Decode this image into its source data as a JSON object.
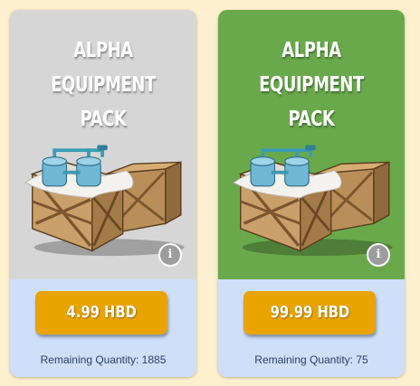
{
  "cards": [
    {
      "title_line1": "ALPHA EQUIPMENT",
      "title_line2": "PACK",
      "info_label": "i",
      "price_label": "4.99 HBD",
      "remaining_label": "Remaining Quantity: 1885",
      "background_color": "#d6d6d6",
      "icon": "crate-with-tanks"
    },
    {
      "title_line1": "ALPHA EQUIPMENT",
      "title_line2": "PACK",
      "info_label": "i",
      "price_label": "99.99 HBD",
      "remaining_label": "Remaining Quantity: 75",
      "background_color": "#69a94b",
      "icon": "crate-with-tanks"
    }
  ],
  "colors": {
    "page_background": "#fdf0cf",
    "footer_background": "#cedff8",
    "button": "#e9a402",
    "text": "#2a3f6c"
  }
}
